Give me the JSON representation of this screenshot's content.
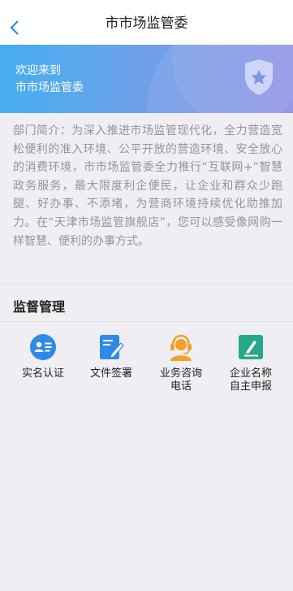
{
  "navbar": {
    "title": "市市场监管委",
    "back_icon": "chevron-left-icon"
  },
  "banner": {
    "welcome": "欢迎来到",
    "name": "市市场监管委",
    "badge_icon": "shield-star-icon",
    "gradient": [
      "#45aff0",
      "#8c8fe4"
    ]
  },
  "intro": {
    "text": "部门简介：为深入推进市场监管现代化，全力营造宽松便利的准入环境、公平开放的营造环境、安全放心的消费环境，市市场监管委全力推行“互联网+”智慧政务服务，最大限度利企便民，让企业和群众少跑腿、好办事、不添堵，为营商环境持续优化助推加力。在“天津市场监管旗舰店”，您可以感受像网购一样智慧、便利的办事方式。"
  },
  "section": {
    "title": "监督管理"
  },
  "services": [
    {
      "label": "实名认证",
      "icon": "id-card-icon",
      "color": "#2f8ae6"
    },
    {
      "label": "文件签署",
      "icon": "document-sign-icon",
      "color": "#2f8ae6"
    },
    {
      "label": "业务咨询电话",
      "icon": "customer-service-icon",
      "color": "#f0a127"
    },
    {
      "label": "企业名称自主申报",
      "icon": "edit-report-icon",
      "color": "#25a98a"
    }
  ]
}
